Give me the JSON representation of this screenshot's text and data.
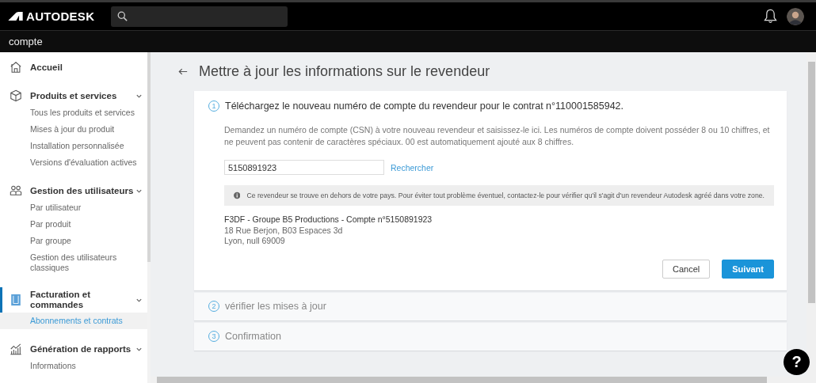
{
  "header": {
    "logo": "AUTODESK"
  },
  "subheader": {
    "title": "compte"
  },
  "sidebar": {
    "items": [
      {
        "label": "Accueil",
        "kind": "home",
        "active": false
      },
      {
        "label": "Produits et services",
        "kind": "cube",
        "active": false,
        "expanded": true,
        "children": [
          {
            "label": "Tous les produits et services",
            "selected": false
          },
          {
            "label": "Mises à jour du produit",
            "selected": false
          },
          {
            "label": "Installation personnalisée",
            "selected": false
          },
          {
            "label": "Versions d'évaluation actives",
            "selected": false
          }
        ]
      },
      {
        "label": "Gestion des utilisateurs",
        "kind": "users",
        "active": false,
        "expanded": true,
        "children": [
          {
            "label": "Par utilisateur",
            "selected": false
          },
          {
            "label": "Par produit",
            "selected": false
          },
          {
            "label": "Par groupe",
            "selected": false
          },
          {
            "label": "Gestion des utilisateurs classiques",
            "selected": false
          }
        ]
      },
      {
        "label": "Facturation et commandes",
        "kind": "billing",
        "active": true,
        "expanded": true,
        "children": [
          {
            "label": "Abonnements et contrats",
            "selected": true
          }
        ]
      },
      {
        "label": "Génération de rapports",
        "kind": "chart",
        "active": false,
        "expanded": true,
        "children": [
          {
            "label": "Informations",
            "selected": false
          }
        ]
      }
    ]
  },
  "page": {
    "title": "Mettre à jour les informations sur le revendeur",
    "steps": [
      {
        "number": "1",
        "title": "Téléchargez le nouveau numéro de compte du revendeur pour le contrat n°110001585942.",
        "expanded": true,
        "description": "Demandez un numéro de compte (CSN) à votre nouveau revendeur et saisissez-le ici. Les numéros de compte doivent posséder 8 ou 10 chiffres, et ne peuvent pas contenir de caractères spéciaux. 00 est automatiquement ajouté aux 8 chiffres.",
        "account_field": {
          "value": "5150891923"
        },
        "search_link": "Rechercher",
        "notice": "Ce revendeur se trouve en dehors de votre pays. Pour éviter tout problème éventuel, contactez-le pour vérifier qu'il s'agit d'un revendeur Autodesk agréé dans votre zone.",
        "reseller": [
          "F3DF - Groupe B5 Productions - Compte n°5150891923",
          "18 Rue Berjon, B03 Espaces 3d",
          "Lyon, null 69009"
        ],
        "buttons": [
          {
            "label": "Cancel",
            "kind": "secondary"
          },
          {
            "label": "Suivant",
            "kind": "primary"
          }
        ]
      },
      {
        "number": "2",
        "title": "vérifier les mises à jour",
        "expanded": false
      },
      {
        "number": "3",
        "title": "Confirmation",
        "expanded": false
      }
    ]
  },
  "help_button": {
    "label": "?"
  }
}
